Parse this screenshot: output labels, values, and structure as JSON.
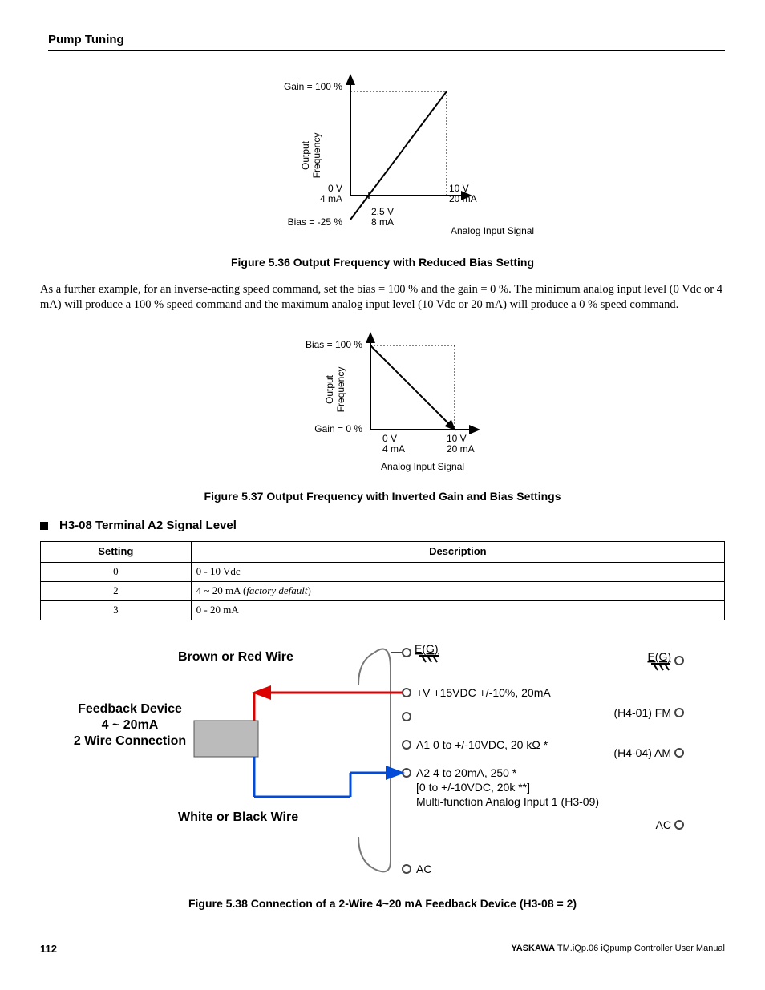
{
  "header": "Pump Tuning",
  "fig36": {
    "gain_label": "Gain = 100 %",
    "bias_label": "Bias = -25 %",
    "y_label_1": "Output",
    "y_label_2": "Frequency",
    "x_label": "Analog Input Signal",
    "origin_v": "0 V",
    "origin_ma": "4 mA",
    "mid_v": "2.5 V",
    "mid_ma": "8 mA",
    "end_v": "10 V",
    "end_ma": "20 mA",
    "caption": "Figure 5.36  Output Frequency with Reduced Bias Setting"
  },
  "paragraph": "As a further example, for an inverse-acting speed command, set the bias = 100 % and the gain = 0 %. The minimum analog input level (0 Vdc or 4 mA) will produce a 100 % speed command and the maximum analog input level (10 Vdc or 20 mA) will produce a 0 % speed command.",
  "fig37": {
    "bias_label": "Bias = 100 %",
    "gain_label": "Gain = 0 %",
    "y_label_1": "Output",
    "y_label_2": "Frequency",
    "x_label": "Analog Input Signal",
    "origin_v": "0 V",
    "origin_ma": "4 mA",
    "end_v": "10 V",
    "end_ma": "20 mA",
    "caption": "Figure 5.37  Output Frequency with Inverted Gain and Bias Settings"
  },
  "section_heading": "H3-08 Terminal A2 Signal Level",
  "table": {
    "headers": [
      "Setting",
      "Description"
    ],
    "rows": [
      {
        "setting": "0",
        "desc": "0 - 10 Vdc"
      },
      {
        "setting": "2",
        "desc_pre": "4 ~ 20 mA (",
        "desc_it": "factory default",
        "desc_post": ")"
      },
      {
        "setting": "3",
        "desc": "0 - 20 mA"
      }
    ]
  },
  "fig38": {
    "brown_red": "Brown or Red Wire",
    "feedback_1": "Feedback Device",
    "feedback_2": "4 ~ 20mA",
    "feedback_3": "2 Wire Connection",
    "white_black": "White or Black Wire",
    "eg": "E(G)",
    "plus_v": "+V  +15VDC +/-10%, 20mA",
    "a1": "A1  0 to +/-10VDC, 20 kΩ  *",
    "a2_1": "A2  4 to 20mA, 250     *",
    "a2_2": "[0 to +/-10VDC, 20k    **]",
    "a2_3": "Multi-function Analog Input 1 (H3-09)",
    "ac": "AC",
    "fm": "(H4-01)  FM",
    "am": "(H4-04)  AM",
    "ac_right": "AC",
    "caption": "Figure 5.38  Connection of a 2-Wire 4~20 mA Feedback Device (H3-08 = 2)"
  },
  "footer": {
    "page": "112",
    "brand": "YASKAWA",
    "doc": " TM.iQp.06 iQpump Controller User Manual"
  }
}
